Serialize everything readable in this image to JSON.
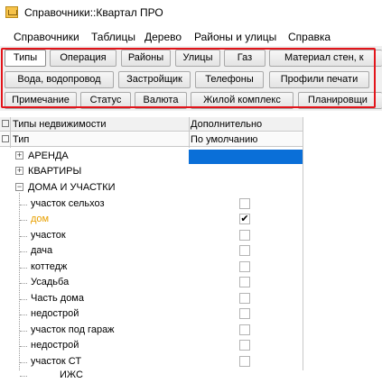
{
  "window": {
    "title": "Справочники::Квартал ПРО"
  },
  "menu": [
    "Справочники",
    "Таблицы",
    "Дерево",
    "Районы и улицы",
    "Справка"
  ],
  "tabs": {
    "row1": [
      "Типы",
      "Операция",
      "Районы",
      "Улицы",
      "Газ",
      "Материал стен, к"
    ],
    "row2": [
      "Вода, водопровод",
      "Застройщик",
      "Телефоны",
      "Профили печати"
    ],
    "row3": [
      "Примечание",
      "Статус",
      "Валюта",
      "Жилой комплекс",
      "Планировщи"
    ],
    "selected": "Типы"
  },
  "grid": {
    "header": {
      "col1": "Типы недвижимости",
      "col2": "Дополнительно"
    },
    "subheader": {
      "col1": "Тип",
      "col2": "По умолчанию"
    },
    "rows": [
      {
        "label": "АРЕНДА",
        "level": 0,
        "expander": "+",
        "checkbox": false,
        "selected": true
      },
      {
        "label": "КВАРТИРЫ",
        "level": 0,
        "expander": "+",
        "checkbox": false
      },
      {
        "label": "ДОМА И УЧАСТКИ",
        "level": 0,
        "expander": "−",
        "checkbox": false
      },
      {
        "label": "участок сельхоз",
        "level": 1,
        "checkbox": true,
        "checked": false
      },
      {
        "label": "дом",
        "level": 1,
        "checkbox": true,
        "checked": true,
        "highlight": "orange"
      },
      {
        "label": "участок",
        "level": 1,
        "checkbox": true,
        "checked": false
      },
      {
        "label": "дача",
        "level": 1,
        "checkbox": true,
        "checked": false
      },
      {
        "label": "коттедж",
        "level": 1,
        "checkbox": true,
        "checked": false
      },
      {
        "label": "Усадьба",
        "level": 1,
        "checkbox": true,
        "checked": false
      },
      {
        "label": "Часть дома",
        "level": 1,
        "checkbox": true,
        "checked": false
      },
      {
        "label": "недострой",
        "level": 1,
        "checkbox": true,
        "checked": false
      },
      {
        "label": "участок под гараж",
        "level": 1,
        "checkbox": true,
        "checked": false
      },
      {
        "label": "недострой",
        "level": 1,
        "checkbox": true,
        "checked": false
      },
      {
        "label": "участок СТ",
        "level": 1,
        "checkbox": true,
        "checked": false
      },
      {
        "label": "ИЖС",
        "level": 1,
        "checkbox": true,
        "checked": false
      }
    ]
  },
  "colors": {
    "selection": "#0a6fd8",
    "highlight_red": "#e3141a",
    "orange_text": "#e8a000"
  }
}
